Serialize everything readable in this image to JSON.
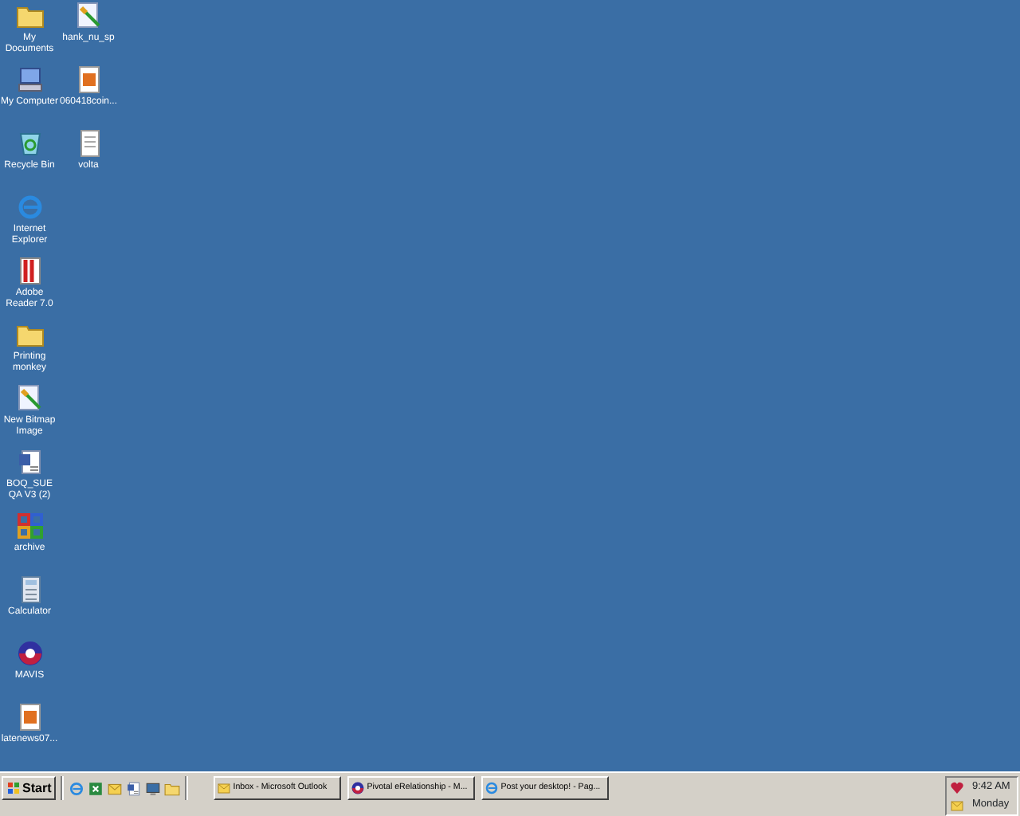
{
  "desktop_icons": [
    {
      "label": "My Documents",
      "kind": "folder"
    },
    {
      "label": "My Computer",
      "kind": "computer"
    },
    {
      "label": "Recycle Bin",
      "kind": "recycle"
    },
    {
      "label": "Internet Explorer",
      "kind": "browser"
    },
    {
      "label": "Adobe Reader 7.0",
      "kind": "pdf"
    },
    {
      "label": "Printing monkey",
      "kind": "folder"
    },
    {
      "label": "New Bitmap Image",
      "kind": "paint"
    },
    {
      "label": "BOQ_SUE QA V3 (2)",
      "kind": "word"
    },
    {
      "label": "archive",
      "kind": "app"
    },
    {
      "label": "Calculator",
      "kind": "calc"
    },
    {
      "label": "MAVIS",
      "kind": "ball"
    },
    {
      "label": "latenews07...",
      "kind": "image"
    },
    {
      "label": "hank_nu_sp",
      "kind": "paint"
    },
    {
      "label": "060418coin...",
      "kind": "image"
    },
    {
      "label": "volta",
      "kind": "document"
    }
  ],
  "taskbar": {
    "start": "Start",
    "quick_launch": [
      {
        "kind": "browser"
      },
      {
        "kind": "excel"
      },
      {
        "kind": "outlook"
      },
      {
        "kind": "word"
      },
      {
        "kind": "desktop"
      },
      {
        "kind": "folder"
      }
    ],
    "tasks": [
      {
        "label": "Inbox - Microsoft Outlook",
        "kind": "outlook"
      },
      {
        "label": "Pivotal eRelationship - M...",
        "kind": "ball"
      },
      {
        "label": "Post your desktop! - Pag...",
        "kind": "browser"
      }
    ],
    "tray": {
      "time": "9:42 AM",
      "day": "Monday"
    }
  }
}
